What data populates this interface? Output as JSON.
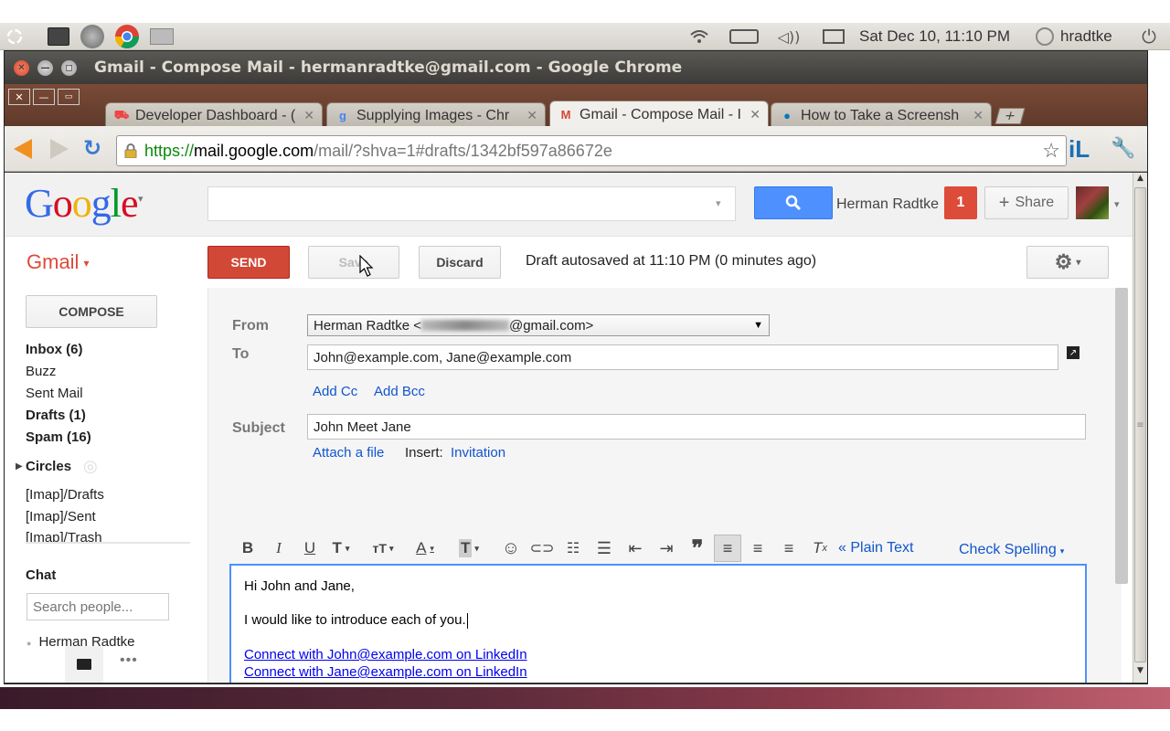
{
  "panel": {
    "datetime": "Sat Dec 10, 11:10 PM",
    "user": "hradtke"
  },
  "window": {
    "title": "Gmail - Compose Mail - hermanradtke@gmail.com - Google Chrome"
  },
  "tabs": [
    {
      "label": "Developer Dashboard - ("
    },
    {
      "label": "Supplying Images - Chr"
    },
    {
      "label": "Gmail - Compose Mail - I"
    },
    {
      "label": "How to Take a Screensh"
    }
  ],
  "address": {
    "scheme": "https://",
    "host": "mail.google.com",
    "path": "/mail/?shva=1#drafts/1342bf597a86672e"
  },
  "toolbar_ext": "iL",
  "header": {
    "logo": "Google",
    "user_name": "Herman Radtke",
    "notif_count": "1",
    "share_label": "Share"
  },
  "gmail_menu": "Gmail",
  "actions": {
    "send": "SEND",
    "save": "Save",
    "discard": "Discard",
    "status": "Draft autosaved at 11:10 PM (0 minutes ago)"
  },
  "sidebar": {
    "compose": "COMPOSE",
    "items": [
      {
        "label": "Inbox (6)",
        "bold": true
      },
      {
        "label": "Buzz",
        "bold": false
      },
      {
        "label": "Sent Mail",
        "bold": false
      },
      {
        "label": "Drafts (1)",
        "bold": true
      },
      {
        "label": "Spam (16)",
        "bold": true
      }
    ],
    "circles": "Circles",
    "labels": [
      "[Imap]/Drafts",
      "[Imap]/Sent",
      "[Imap]/Trash"
    ],
    "chat": "Chat",
    "search_placeholder": "Search people...",
    "contact": "Herman Radtke"
  },
  "compose": {
    "from_label": "From",
    "from_value": "Herman Radtke <",
    "from_suffix": "@gmail.com>",
    "to_label": "To",
    "to_value": "John@example.com, Jane@example.com",
    "add_cc": "Add Cc",
    "add_bcc": "Add Bcc",
    "subject_label": "Subject",
    "subject_value": "John Meet Jane",
    "attach": "Attach a file",
    "insert_label": "Insert:",
    "invitation": "Invitation",
    "plain_text": "« Plain Text",
    "check_spelling": "Check Spelling",
    "body_line1": "Hi John and Jane,",
    "body_line2": "I would like to introduce each of you.",
    "link1": "Connect with John@example.com on LinkedIn",
    "link2": "Connect with Jane@example.com on LinkedIn"
  },
  "colors": {
    "send_red": "#d14836",
    "search_blue": "#4d90fe",
    "gmail_red": "#dd4b39",
    "link_blue": "#15c"
  }
}
